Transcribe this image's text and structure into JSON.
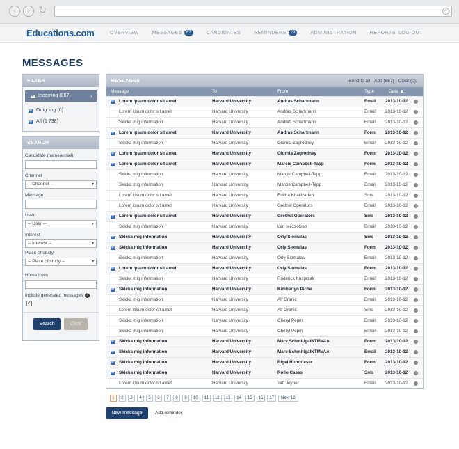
{
  "browser": {
    "back": "‹",
    "forward": "›",
    "reload": "↻",
    "url": "",
    "clear": "×"
  },
  "header": {
    "logo": "Educations.com",
    "nav": [
      {
        "label": "OVERVIEW",
        "badge": null
      },
      {
        "label": "MESSAGES",
        "badge": "67"
      },
      {
        "label": "CANDIDATES",
        "badge": null
      },
      {
        "label": "REMINDERS",
        "badge": "29"
      },
      {
        "label": "ADMINISTRATION",
        "badge": null
      },
      {
        "label": "REPORTS",
        "badge": null
      }
    ],
    "logout": "LOG OUT"
  },
  "page_title": "MESSAGES",
  "filter": {
    "title": "FILTER",
    "items": [
      {
        "label": "Incoming (867)",
        "active": true
      },
      {
        "label": "Outgoing (0)",
        "active": false
      },
      {
        "label": "All (1 738)",
        "active": false
      }
    ],
    "chevron": "›"
  },
  "search": {
    "title": "SEARCH",
    "candidate_label": "Candidate (name/email)",
    "candidate_value": "",
    "channel_label": "Channel",
    "channel_value": "-- Channel --",
    "message_label": "Message",
    "message_value": "",
    "user_label": "User",
    "user_value": "-- User --",
    "interest_label": "Interest",
    "interest_value": "-- Interest --",
    "place_label": "Place of study",
    "place_value": "-- Place of study --",
    "hometown_label": "Home town",
    "hometown_value": "",
    "include_label": "Include generated messages",
    "include_checked": true,
    "search_button": "Search",
    "clear_button": "Clear",
    "arrow": "▾",
    "help": "?",
    "check": "✓"
  },
  "messages": {
    "title": "MESSAGES",
    "actions": [
      "Send to all",
      "Add (867)",
      "Clear (0)"
    ],
    "columns": {
      "message": "Message",
      "to": "To",
      "from": "From",
      "type": "Type",
      "date": "Date ▲"
    },
    "rows": [
      {
        "bold": true,
        "icon": true,
        "message": "Lorem ipsum dolor sit amet",
        "to": "Harvard University",
        "from": "Andras Schartmann",
        "type": "Email",
        "date": "2013-10-12"
      },
      {
        "bold": false,
        "icon": false,
        "message": "Lorem ipsum dolor sit amet",
        "to": "Harvard University",
        "from": "Andras Schartmann",
        "type": "Email",
        "date": "2013-10-12"
      },
      {
        "bold": false,
        "icon": false,
        "message": "Skicka mig information",
        "to": "Harvard University",
        "from": "Andras Schartmann",
        "type": "Email",
        "date": "2013-10-12"
      },
      {
        "bold": true,
        "icon": true,
        "message": "Lorem ipsum dolor sit amet",
        "to": "Harvard University",
        "from": "Andras Schartmann",
        "type": "Form",
        "date": "2013-10-12"
      },
      {
        "bold": false,
        "icon": false,
        "message": "Skicka mig information",
        "to": "Harvard University",
        "from": "Glornia Zagrodney",
        "type": "Email",
        "date": "2013-10-12"
      },
      {
        "bold": true,
        "icon": true,
        "message": "Lorem ipsum dolor sit amet",
        "to": "Harvard University",
        "from": "Glornia Zagrodney",
        "type": "Form",
        "date": "2013-10-12"
      },
      {
        "bold": true,
        "icon": true,
        "message": "Lorem ipsum dolor sit amet",
        "to": "Harvard University",
        "from": "Marcie Campbell-Tapp",
        "type": "Form",
        "date": "2013-10-12"
      },
      {
        "bold": false,
        "icon": false,
        "message": "Skicka mig information",
        "to": "Harvard University",
        "from": "Marcie Campbell-Tapp",
        "type": "Email",
        "date": "2013-10-12"
      },
      {
        "bold": false,
        "icon": false,
        "message": "Skicka mig information",
        "to": "Harvard University",
        "from": "Marcie Campbell-Tapp",
        "type": "Email",
        "date": "2013-10-12"
      },
      {
        "bold": false,
        "icon": false,
        "message": "Lorem ipsum dolor sit amet",
        "to": "Harvard University",
        "from": "Editha Khalilzadeh",
        "type": "Sms",
        "date": "2013-10-12"
      },
      {
        "bold": false,
        "icon": false,
        "message": "Lorem ipsum dolor sit amet",
        "to": "Harvard University",
        "from": "Grethel Operators",
        "type": "Email",
        "date": "2013-10-12"
      },
      {
        "bold": true,
        "icon": true,
        "message": "Lorem ipsum dolor sit amet",
        "to": "Harvard University",
        "from": "Grethel Operators",
        "type": "Sms",
        "date": "2013-10-12"
      },
      {
        "bold": false,
        "icon": false,
        "message": "Skicka mig information",
        "to": "Harvard University",
        "from": "Lan Mezzoluso",
        "type": "Email",
        "date": "2013-10-12"
      },
      {
        "bold": true,
        "icon": true,
        "message": "Skicka mig information",
        "to": "Harvard University",
        "from": "Orly Siomalas",
        "type": "Sms",
        "date": "2013-10-12"
      },
      {
        "bold": true,
        "icon": true,
        "message": "Skicka mig information",
        "to": "Harvard University",
        "from": "Orly Siomalas",
        "type": "Form",
        "date": "2013-10-12"
      },
      {
        "bold": false,
        "icon": false,
        "message": "Skicka mig information",
        "to": "Harvard University",
        "from": "Orly Siomalas",
        "type": "Email",
        "date": "2013-10-12"
      },
      {
        "bold": true,
        "icon": true,
        "message": "Lorem ipsum dolor sit amet",
        "to": "Harvard University",
        "from": "Orly Siomalas",
        "type": "Form",
        "date": "2013-10-12"
      },
      {
        "bold": false,
        "icon": false,
        "message": "Skicka mig information",
        "to": "Harvard University",
        "from": "Roderick Kasprzak",
        "type": "Email",
        "date": "2013-10-12"
      },
      {
        "bold": true,
        "icon": true,
        "message": "Skicka mig information",
        "to": "Harvard University",
        "from": "Kimberlyn Piche",
        "type": "Form",
        "date": "2013-10-12"
      },
      {
        "bold": false,
        "icon": false,
        "message": "Skicka mig information",
        "to": "Harvard University",
        "from": "Alf Granic",
        "type": "Email",
        "date": "2013-10-12"
      },
      {
        "bold": false,
        "icon": false,
        "message": "Lorem ipsum dolor sit amet",
        "to": "Harvard University",
        "from": "Alf Granic",
        "type": "Sms",
        "date": "2013-10-12"
      },
      {
        "bold": false,
        "icon": false,
        "message": "Skicka mig information",
        "to": "Harvard University",
        "from": "Cheryl Pepin",
        "type": "Email",
        "date": "2013-10-12"
      },
      {
        "bold": false,
        "icon": false,
        "message": "Skicka mig information",
        "to": "Harvard University",
        "from": "Cheryl Pepin",
        "type": "Email",
        "date": "2013-10-12"
      },
      {
        "bold": true,
        "icon": true,
        "message": "Skicka mig information",
        "to": "Harvard University",
        "from": "Marv SchmitigaINTMVAA",
        "type": "Form",
        "date": "2013-10-12"
      },
      {
        "bold": true,
        "icon": true,
        "message": "Skicka mig information",
        "to": "Harvard University",
        "from": "Marv SchmitigaINTMVAA",
        "type": "Email",
        "date": "2013-10-12"
      },
      {
        "bold": true,
        "icon": true,
        "message": "Skicka mig information",
        "to": "Harvard University",
        "from": "Rigel Hundrieser",
        "type": "Form",
        "date": "2013-10-12"
      },
      {
        "bold": true,
        "icon": true,
        "message": "Skicka mig information",
        "to": "Harvard University",
        "from": "Rollo Casas",
        "type": "Sms",
        "date": "2013-10-12"
      },
      {
        "bold": false,
        "icon": false,
        "message": "Lorem ipsum dolor sit amet",
        "to": "Harvard University",
        "from": "Tan Joyner",
        "type": "Email",
        "date": "2013-10-12"
      }
    ]
  },
  "pagination": {
    "pages": [
      "1",
      "2",
      "3",
      "4",
      "5",
      "6",
      "7",
      "8",
      "9",
      "10",
      "11",
      "12",
      "13",
      "14",
      "15",
      "16",
      "17"
    ],
    "current": "1",
    "next": "Next 18"
  },
  "footer": {
    "new_message": "New message",
    "add_reminder": "Add reminder"
  }
}
